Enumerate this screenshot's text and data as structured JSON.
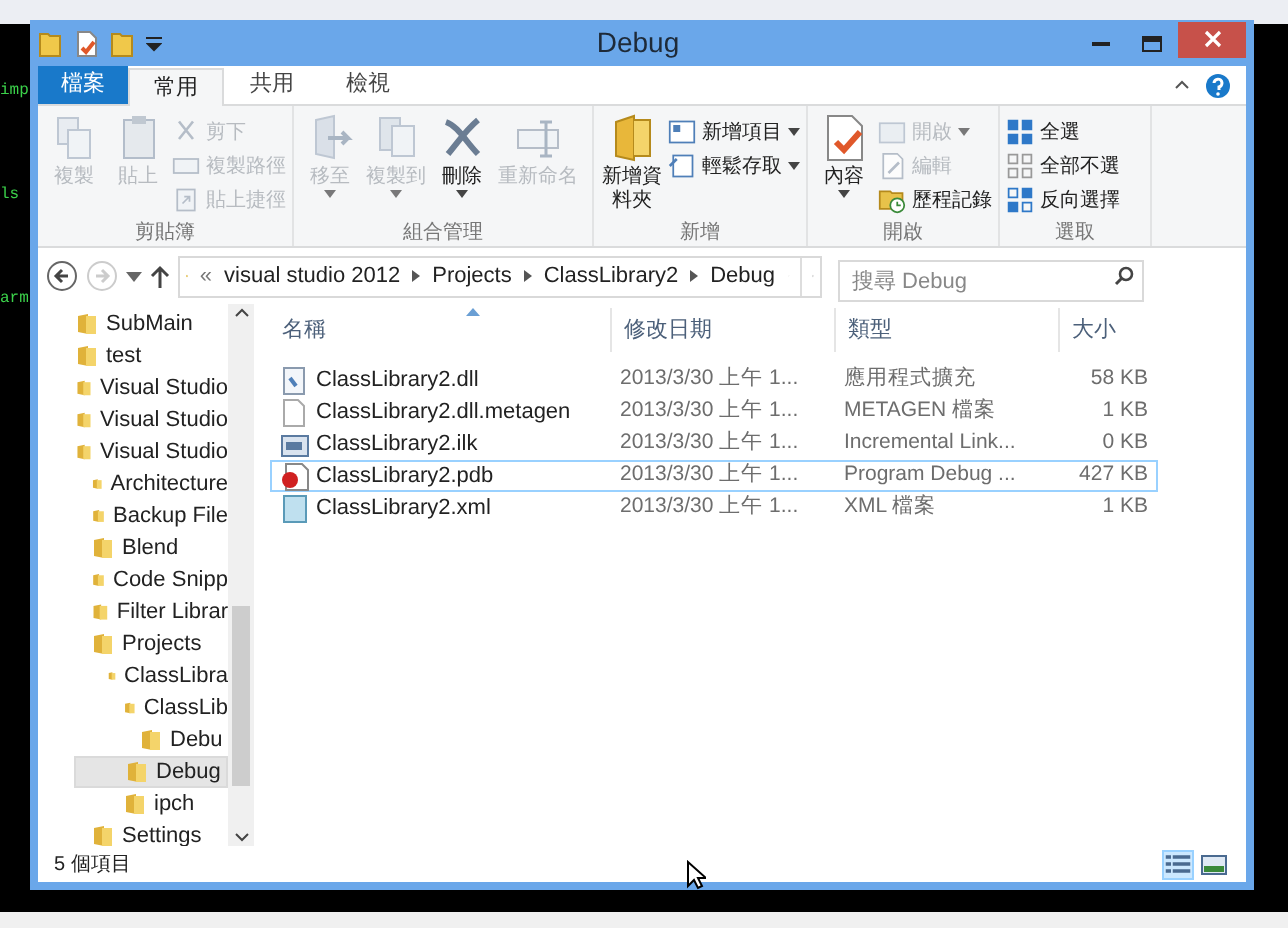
{
  "terminal": {
    "fragments": [
      "imp",
      "ls",
      "arm"
    ]
  },
  "window": {
    "title": "Debug"
  },
  "tabs": [
    {
      "label": "檔案",
      "kind": "file",
      "selected": false
    },
    {
      "label": "常用",
      "kind": "tab",
      "selected": true
    },
    {
      "label": "共用",
      "kind": "tab",
      "selected": false
    },
    {
      "label": "檢視",
      "kind": "tab",
      "selected": false
    }
  ],
  "ribbon": [
    {
      "label": "剪貼簿",
      "buttons": [
        {
          "label": "複製",
          "kind": "large",
          "disabled": true
        },
        {
          "label": "貼上",
          "kind": "large",
          "disabled": true
        },
        {
          "label": "剪下",
          "kind": "small",
          "disabled": true
        },
        {
          "label": "複製路徑",
          "kind": "small",
          "disabled": true
        },
        {
          "label": "貼上捷徑",
          "kind": "small",
          "disabled": true
        }
      ]
    },
    {
      "label": "組合管理",
      "buttons": [
        {
          "label": "移至",
          "kind": "large",
          "disabled": true,
          "dropdown": true
        },
        {
          "label": "複製到",
          "kind": "large",
          "disabled": true,
          "dropdown": true
        },
        {
          "label": "刪除",
          "kind": "large",
          "disabled": false,
          "dropdown": true
        },
        {
          "label": "重新命名",
          "kind": "large",
          "disabled": true
        }
      ]
    },
    {
      "label": "新增",
      "buttons": [
        {
          "label": "新增資料夾",
          "kind": "large",
          "disabled": false
        },
        {
          "label": "新增項目",
          "kind": "small",
          "disabled": false,
          "dropdown": true
        },
        {
          "label": "輕鬆存取",
          "kind": "small",
          "disabled": false,
          "dropdown": true
        }
      ]
    },
    {
      "label": "開啟",
      "buttons": [
        {
          "label": "內容",
          "kind": "large",
          "disabled": false,
          "dropdown": true
        },
        {
          "label": "開啟",
          "kind": "small",
          "disabled": true,
          "dropdown": true
        },
        {
          "label": "編輯",
          "kind": "small",
          "disabled": true
        },
        {
          "label": "歷程記錄",
          "kind": "small",
          "disabled": false
        }
      ]
    },
    {
      "label": "選取",
      "buttons": [
        {
          "label": "全選",
          "kind": "small",
          "disabled": false
        },
        {
          "label": "全部不選",
          "kind": "small",
          "disabled": false
        },
        {
          "label": "反向選擇",
          "kind": "small",
          "disabled": false
        }
      ]
    }
  ],
  "address": {
    "overflow": "«",
    "crumbs": [
      "visual studio 2012",
      "Projects",
      "ClassLibrary2",
      "Debug"
    ]
  },
  "search": {
    "placeholder": "搜尋 Debug"
  },
  "sidebar": {
    "items": [
      {
        "label": "SubMain",
        "selected": false
      },
      {
        "label": "test",
        "selected": false
      },
      {
        "label": "Visual Studio",
        "selected": false
      },
      {
        "label": "Visual Studio",
        "selected": false
      },
      {
        "label": "Visual Studio",
        "selected": false,
        "children": [
          {
            "label": "Architecture",
            "selected": false
          },
          {
            "label": "Backup File",
            "selected": false
          },
          {
            "label": "Blend",
            "selected": false
          },
          {
            "label": "Code Snipp",
            "selected": false
          },
          {
            "label": "Filter Librar",
            "selected": false
          },
          {
            "label": "Projects",
            "selected": false,
            "children": [
              {
                "label": "ClassLibra",
                "selected": false,
                "children": [
                  {
                    "label": "ClassLib",
                    "selected": false,
                    "children": [
                      {
                        "label": "Debu",
                        "selected": false
                      }
                    ]
                  },
                  {
                    "label": "Debug",
                    "selected": true
                  },
                  {
                    "label": "ipch",
                    "selected": false
                  }
                ]
              }
            ]
          },
          {
            "label": "Settings",
            "selected": false
          }
        ]
      }
    ]
  },
  "table": {
    "columns": [
      "名稱",
      "修改日期",
      "類型",
      "大小"
    ],
    "rows": [
      {
        "name": "ClassLibrary2.dll",
        "modified": "2013/3/30 上午 1...",
        "type": "應用程式擴充",
        "size": "58 KB",
        "selected": false
      },
      {
        "name": "ClassLibrary2.dll.metagen",
        "modified": "2013/3/30 上午 1...",
        "type": "METAGEN 檔案",
        "size": "1 KB",
        "selected": false
      },
      {
        "name": "ClassLibrary2.ilk",
        "modified": "2013/3/30 上午 1...",
        "type": "Incremental Link...",
        "size": "0 KB",
        "selected": false
      },
      {
        "name": "ClassLibrary2.pdb",
        "modified": "2013/3/30 上午 1...",
        "type": "Program Debug ...",
        "size": "427 KB",
        "selected": true
      },
      {
        "name": "ClassLibrary2.xml",
        "modified": "2013/3/30 上午 1...",
        "type": "XML 檔案",
        "size": "1 KB",
        "selected": false
      }
    ]
  },
  "status_bar": {
    "text": "5 個項目",
    "views": [
      {
        "kind": "details",
        "selected": true
      },
      {
        "kind": "thumbnails",
        "selected": false
      }
    ]
  }
}
